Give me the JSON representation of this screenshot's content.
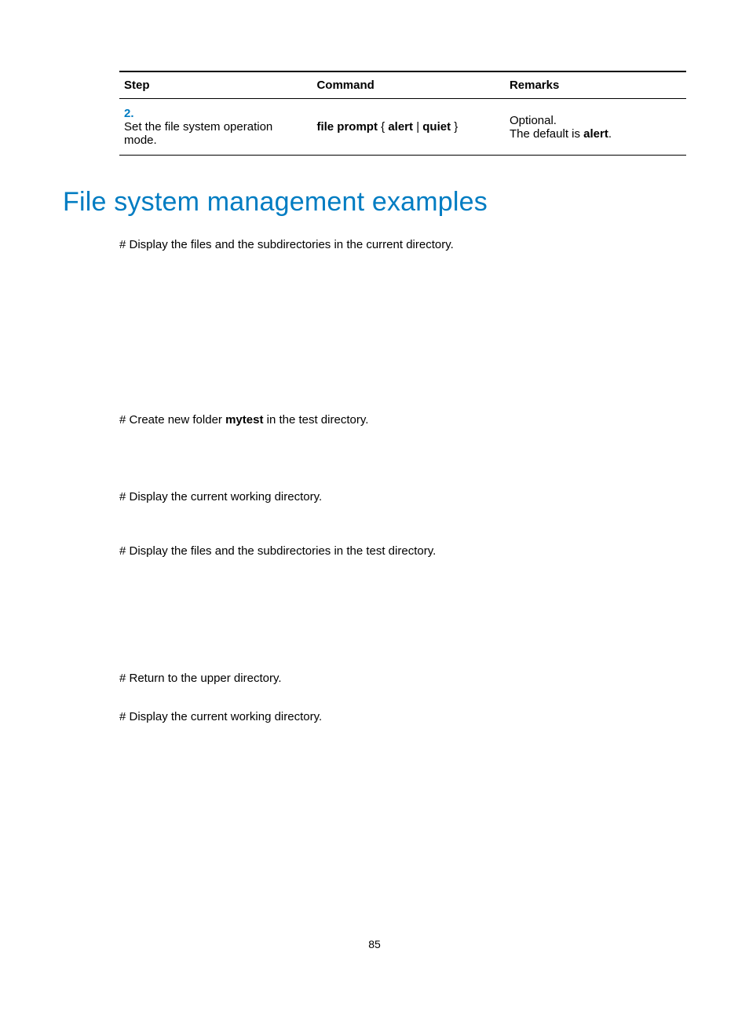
{
  "table": {
    "headers": [
      "Step",
      "Command",
      "Remarks"
    ],
    "row": {
      "num": "2.",
      "step": "Set the file system operation mode.",
      "cmd_prefix": "file prompt",
      "cmd_opt1": "alert",
      "cmd_opt2": "quiet",
      "remark1": "Optional.",
      "remark2_pre": "The default is ",
      "remark2_bold": "alert",
      "remark2_post": "."
    }
  },
  "heading": "File system management examples",
  "p1": "# Display the files and the subdirectories in the current directory.",
  "p2_pre": "# Create new folder ",
  "p2_bold": "mytest",
  "p2_post": " in the test directory.",
  "p3": "# Display the current working directory.",
  "p4": "# Display the files and the subdirectories in the test directory.",
  "p5": "# Return to the upper directory.",
  "p6": "# Display the current working directory.",
  "page_number": "85"
}
